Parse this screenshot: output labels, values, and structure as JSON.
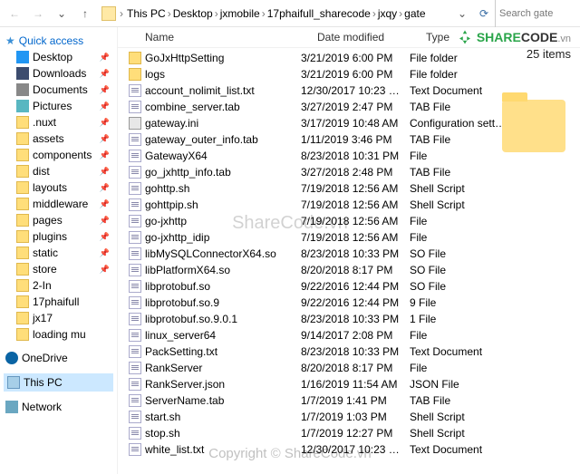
{
  "nav": {
    "back": "←",
    "fwd": "→",
    "up": "↑",
    "refresh": "⟳",
    "dropdown": "⌄",
    "search_placeholder": "Search gate"
  },
  "breadcrumb": [
    "This PC",
    "Desktop",
    "jxmobile",
    "17phaifull_sharecode",
    "jxqy",
    "gate"
  ],
  "brand": {
    "share": "SHARE",
    "code": "CODE",
    "suffix": ".vn",
    "count": "25 items"
  },
  "sidebar": {
    "quick": "Quick access",
    "items": [
      {
        "label": "Desktop",
        "ico": "desktop",
        "pin": true
      },
      {
        "label": "Downloads",
        "ico": "download",
        "pin": true
      },
      {
        "label": "Documents",
        "ico": "doc",
        "pin": true
      },
      {
        "label": "Pictures",
        "ico": "pic",
        "pin": true
      },
      {
        "label": ".nuxt",
        "ico": "folder",
        "pin": true
      },
      {
        "label": "assets",
        "ico": "folder",
        "pin": true
      },
      {
        "label": "components",
        "ico": "folder",
        "pin": true
      },
      {
        "label": "dist",
        "ico": "folder",
        "pin": true
      },
      {
        "label": "layouts",
        "ico": "folder",
        "pin": true
      },
      {
        "label": "middleware",
        "ico": "folder",
        "pin": true
      },
      {
        "label": "pages",
        "ico": "folder",
        "pin": true
      },
      {
        "label": "plugins",
        "ico": "folder",
        "pin": true
      },
      {
        "label": "static",
        "ico": "folder",
        "pin": true
      },
      {
        "label": "store",
        "ico": "folder",
        "pin": true
      },
      {
        "label": "2-In",
        "ico": "folder",
        "pin": false
      },
      {
        "label": "17phaifull",
        "ico": "folder",
        "pin": false
      },
      {
        "label": "jx17",
        "ico": "folder",
        "pin": false
      },
      {
        "label": "loading mu",
        "ico": "folder",
        "pin": false
      }
    ],
    "onedrive": "OneDrive",
    "thispc": "This PC",
    "network": "Network"
  },
  "columns": {
    "name": "Name",
    "date": "Date modified",
    "type": "Type"
  },
  "files": [
    {
      "name": "GoJxHttpSetting",
      "date": "3/21/2019 6:00 PM",
      "type": "File folder",
      "ico": "folder"
    },
    {
      "name": "logs",
      "date": "3/21/2019 6:00 PM",
      "type": "File folder",
      "ico": "folder"
    },
    {
      "name": "account_nolimit_list.txt",
      "date": "12/30/2017 10:23 …",
      "type": "Text Document",
      "ico": "fileimg"
    },
    {
      "name": "combine_server.tab",
      "date": "3/27/2019 2:47 PM",
      "type": "TAB File",
      "ico": "fileimg"
    },
    {
      "name": "gateway.ini",
      "date": "3/17/2019 10:48 AM",
      "type": "Configuration sett…",
      "ico": "gear"
    },
    {
      "name": "gateway_outer_info.tab",
      "date": "1/11/2019 3:46 PM",
      "type": "TAB File",
      "ico": "fileimg"
    },
    {
      "name": "GatewayX64",
      "date": "8/23/2018 10:31 PM",
      "type": "File",
      "ico": "fileimg"
    },
    {
      "name": "go_jxhttp_info.tab",
      "date": "3/27/2018 2:48 PM",
      "type": "TAB File",
      "ico": "fileimg"
    },
    {
      "name": "gohttp.sh",
      "date": "7/19/2018 12:56 AM",
      "type": "Shell Script",
      "ico": "fileimg"
    },
    {
      "name": "gohttpip.sh",
      "date": "7/19/2018 12:56 AM",
      "type": "Shell Script",
      "ico": "fileimg"
    },
    {
      "name": "go-jxhttp",
      "date": "7/19/2018 12:56 AM",
      "type": "File",
      "ico": "fileimg"
    },
    {
      "name": "go-jxhttp_idip",
      "date": "7/19/2018 12:56 AM",
      "type": "File",
      "ico": "fileimg"
    },
    {
      "name": "libMySQLConnectorX64.so",
      "date": "8/23/2018 10:33 PM",
      "type": "SO File",
      "ico": "fileimg"
    },
    {
      "name": "libPlatformX64.so",
      "date": "8/20/2018 8:17 PM",
      "type": "SO File",
      "ico": "fileimg"
    },
    {
      "name": "libprotobuf.so",
      "date": "9/22/2016 12:44 PM",
      "type": "SO File",
      "ico": "fileimg"
    },
    {
      "name": "libprotobuf.so.9",
      "date": "9/22/2016 12:44 PM",
      "type": "9 File",
      "ico": "fileimg"
    },
    {
      "name": "libprotobuf.so.9.0.1",
      "date": "8/23/2018 10:33 PM",
      "type": "1 File",
      "ico": "fileimg"
    },
    {
      "name": "linux_server64",
      "date": "9/14/2017 2:08 PM",
      "type": "File",
      "ico": "fileimg"
    },
    {
      "name": "PackSetting.txt",
      "date": "8/23/2018 10:33 PM",
      "type": "Text Document",
      "ico": "fileimg"
    },
    {
      "name": "RankServer",
      "date": "8/20/2018 8:17 PM",
      "type": "File",
      "ico": "fileimg"
    },
    {
      "name": "RankServer.json",
      "date": "1/16/2019 11:54 AM",
      "type": "JSON File",
      "ico": "fileimg"
    },
    {
      "name": "ServerName.tab",
      "date": "1/7/2019 1:41 PM",
      "type": "TAB File",
      "ico": "fileimg"
    },
    {
      "name": "start.sh",
      "date": "1/7/2019 1:03 PM",
      "type": "Shell Script",
      "ico": "fileimg"
    },
    {
      "name": "stop.sh",
      "date": "1/7/2019 12:27 PM",
      "type": "Shell Script",
      "ico": "fileimg"
    },
    {
      "name": "white_list.txt",
      "date": "12/30/2017 10:23 …",
      "type": "Text Document",
      "ico": "fileimg"
    }
  ],
  "watermark": "ShareCode.vn",
  "watermark2": "Copyright © ShareCode.vn"
}
